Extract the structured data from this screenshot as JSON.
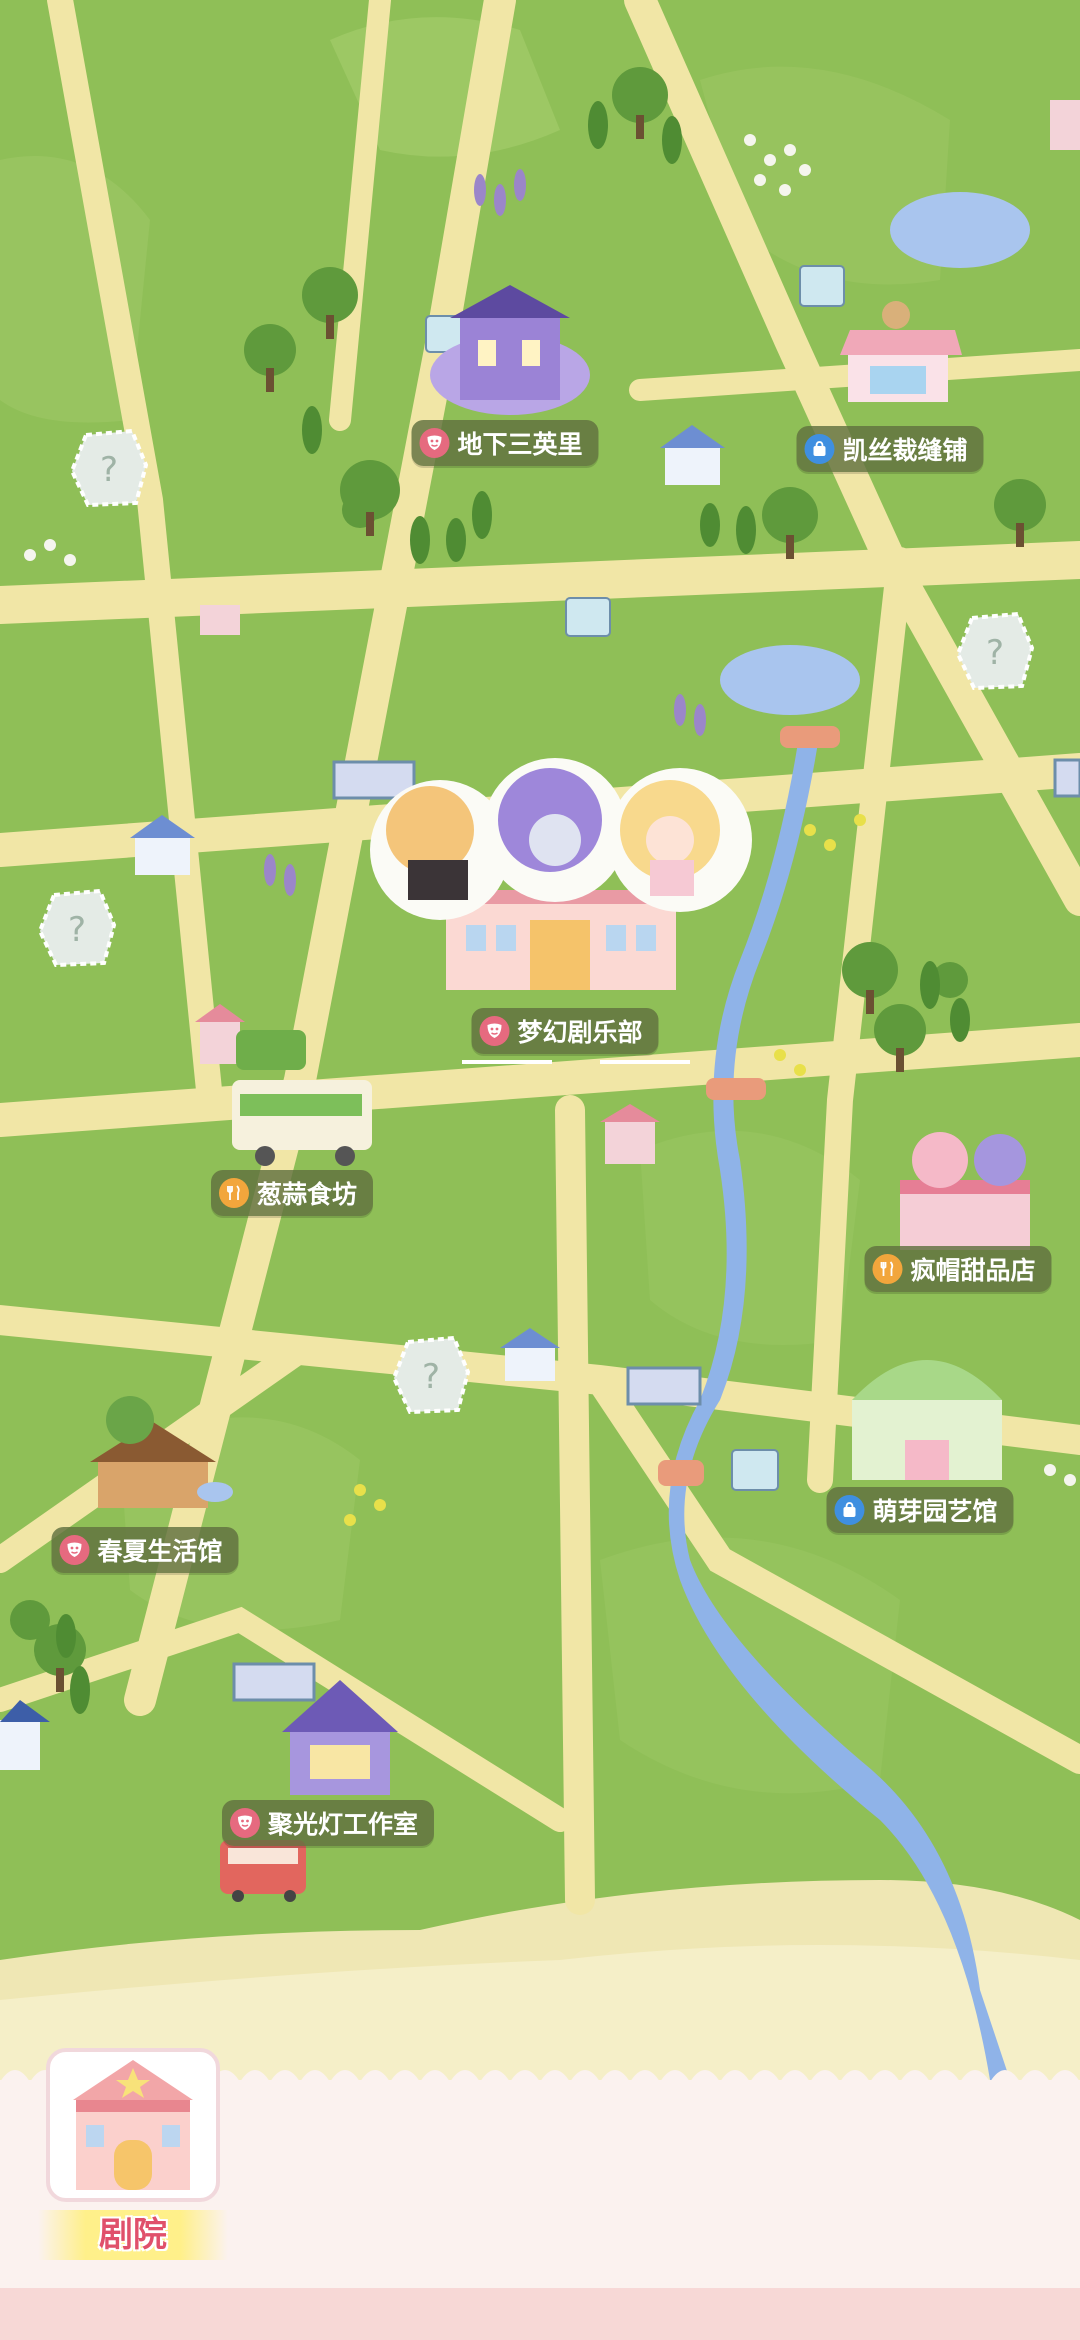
{
  "map": {
    "locations": [
      {
        "id": "underground",
        "name": "地下三英里",
        "icon": "theater-mask-icon"
      },
      {
        "id": "tailor",
        "name": "凯丝裁缝铺",
        "icon": "shopping-bag-icon"
      },
      {
        "id": "dream-club",
        "name": "梦幻剧乐部",
        "icon": "theater-mask-icon"
      },
      {
        "id": "garlic-kitchen",
        "name": "葱蒜食坊",
        "icon": "fork-knife-icon"
      },
      {
        "id": "hatter-dessert",
        "name": "疯帽甜品店",
        "icon": "fork-knife-icon"
      },
      {
        "id": "sprout-garden",
        "name": "萌芽园艺馆",
        "icon": "shopping-bag-icon"
      },
      {
        "id": "spring-summer",
        "name": "春夏生活馆",
        "icon": "theater-mask-icon"
      },
      {
        "id": "spotlight-studio",
        "name": "聚光灯工作室",
        "icon": "theater-mask-icon"
      }
    ],
    "unknown_marker": "?",
    "colors": {
      "grass": "#8fbf57",
      "road": "#f1e6a6",
      "river": "#8fb3e8",
      "label_bg": "#607040",
      "theater_icon": "#e66a7f",
      "shop_icon": "#3f8fe0",
      "food_icon": "#f2a63c"
    }
  },
  "bottom_bar": {
    "active_tab": "剧院",
    "tab_icon": "theater-building-icon"
  }
}
